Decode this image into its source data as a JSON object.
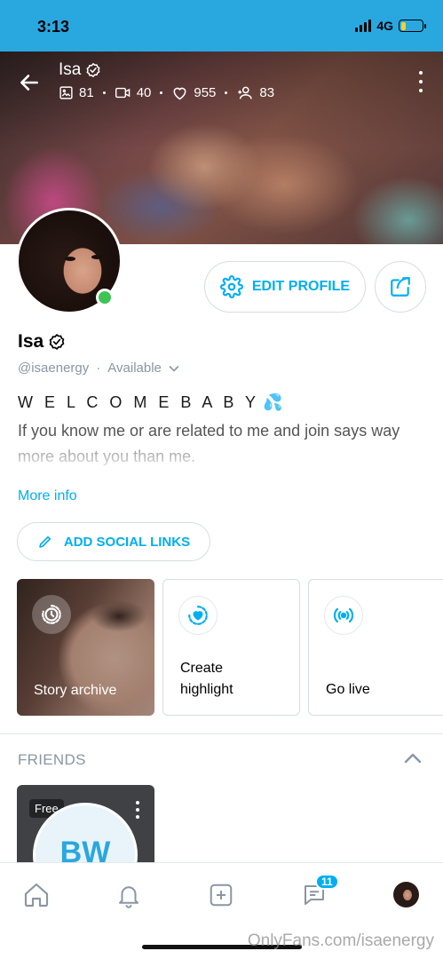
{
  "status_bar": {
    "time": "3:13",
    "network": "4G",
    "battery_level": 0.25,
    "battery_color": "#f5d327",
    "bg_color": "#29a8e0"
  },
  "cover": {
    "name": "Isa",
    "verified": true,
    "stats": [
      {
        "icon": "image-icon",
        "value": "81"
      },
      {
        "icon": "video-icon",
        "value": "40"
      },
      {
        "icon": "heart-icon",
        "value": "955"
      },
      {
        "icon": "fans-icon",
        "value": "83"
      }
    ]
  },
  "profile": {
    "name": "Isa",
    "handle": "@isaenergy",
    "status": "Available",
    "online": true,
    "online_color": "#3cc454",
    "bio_title": "W E L C O M E B A B Y",
    "bio_emoji": "💦",
    "bio_text": "If you know me or are related to me and join says way more about you than me.",
    "more_info": "More info"
  },
  "actions": {
    "edit_profile": "EDIT PROFILE",
    "add_social_links": "ADD SOCIAL LINKS"
  },
  "cards": {
    "story_archive": "Story archive",
    "create_highlight_line1": "Create",
    "create_highlight_line2": "highlight",
    "go_live": "Go live"
  },
  "friends": {
    "title": "FRIENDS",
    "items": [
      {
        "badge": "Free",
        "initials": "BW"
      }
    ]
  },
  "bottom_nav": {
    "items": [
      "home-icon",
      "bell-icon",
      "add-post-icon",
      "messages-icon",
      "profile-avatar"
    ],
    "messages_badge": "11"
  },
  "watermark": "OnlyFans.com/isaenergy",
  "accent_color": "#00aff0"
}
